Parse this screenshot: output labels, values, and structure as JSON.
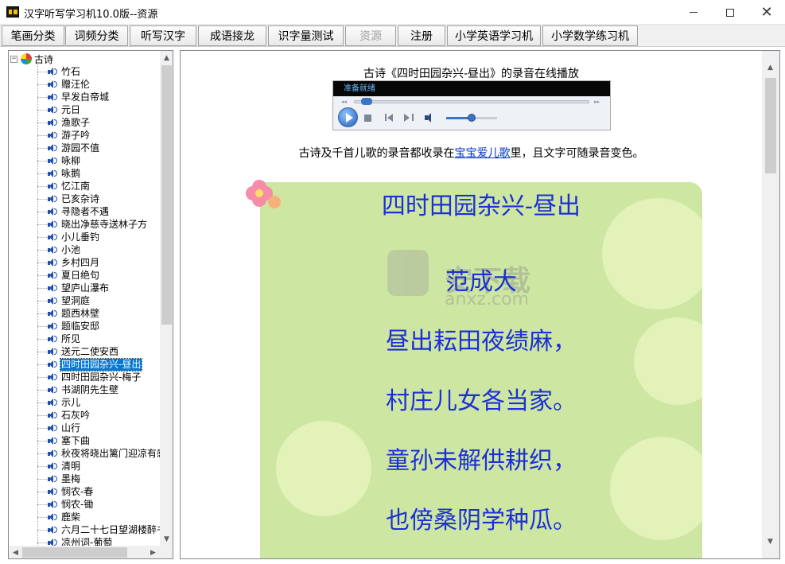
{
  "window": {
    "title": "汉字听写学习机10.0版--资源",
    "minimize_glyph": "",
    "maximize_glyph": "",
    "close_glyph": "✕"
  },
  "toolbar": {
    "buttons": [
      {
        "label": "笔画分类",
        "enabled": true
      },
      {
        "label": "词频分类",
        "enabled": true
      },
      {
        "label": "听写汉字",
        "enabled": true
      },
      {
        "label": "成语接龙",
        "enabled": true
      },
      {
        "label": "识字量测试",
        "enabled": true
      },
      {
        "label": "资源",
        "enabled": false
      },
      {
        "label": "注册",
        "enabled": true
      },
      {
        "label": "小学英语学习机",
        "enabled": true
      },
      {
        "label": "小学数学练习机",
        "enabled": true
      }
    ]
  },
  "tree": {
    "root": {
      "label": "古诗",
      "expander": "−"
    },
    "items": [
      "竹石",
      "赠汪伦",
      "早发白帝城",
      "元日",
      "渔歌子",
      "游子吟",
      "游园不值",
      "咏柳",
      "咏鹅",
      "忆江南",
      "已亥杂诗",
      "寻隐者不遇",
      "晓出净慈寺送林子方",
      "小儿垂钓",
      "小池",
      "乡村四月",
      "夏日绝句",
      "望庐山瀑布",
      "望洞庭",
      "题西林壁",
      "题临安邸",
      "所见",
      "送元二使安西",
      "四时田园杂兴-昼出",
      "四时田园杂兴-梅子",
      "书湖阴先生壁",
      "示儿",
      "石灰吟",
      "山行",
      "塞下曲",
      "秋夜将晓出篱门迎凉有感",
      "清明",
      "墨梅",
      "悯农-春",
      "悯农-锄",
      "鹿柴",
      "六月二十七日望湖楼醉书",
      "凉州词-葡萄"
    ],
    "selected_index": 23,
    "scroll_up": "▲",
    "scroll_down": "▼",
    "scroll_left": "◀",
    "scroll_right": "▶"
  },
  "content": {
    "player_title": "古诗《四时田园杂兴-昼出》的录音在线播放",
    "player": {
      "status": "准备就绪",
      "seek_start": "◂◂",
      "seek_end": "▸▸",
      "progress": 0.03,
      "volume": 0.5
    },
    "note_prefix": "古诗及千首儿歌的录音都收录在",
    "note_link": "宝宝爱儿歌",
    "note_suffix": "里，且文字可随录音变色。",
    "poem": {
      "title": "四时田园杂兴-昼出",
      "author": "范成大",
      "lines": [
        "昼出耘田夜绩麻，",
        "村庄儿女各当家。",
        "童孙未解供耕织，",
        "也傍桑阴学种瓜。"
      ]
    },
    "watermark": {
      "main": "安下载",
      "sub": "anxz.com"
    },
    "scroll_up": "▲",
    "scroll_down": "▼"
  }
}
